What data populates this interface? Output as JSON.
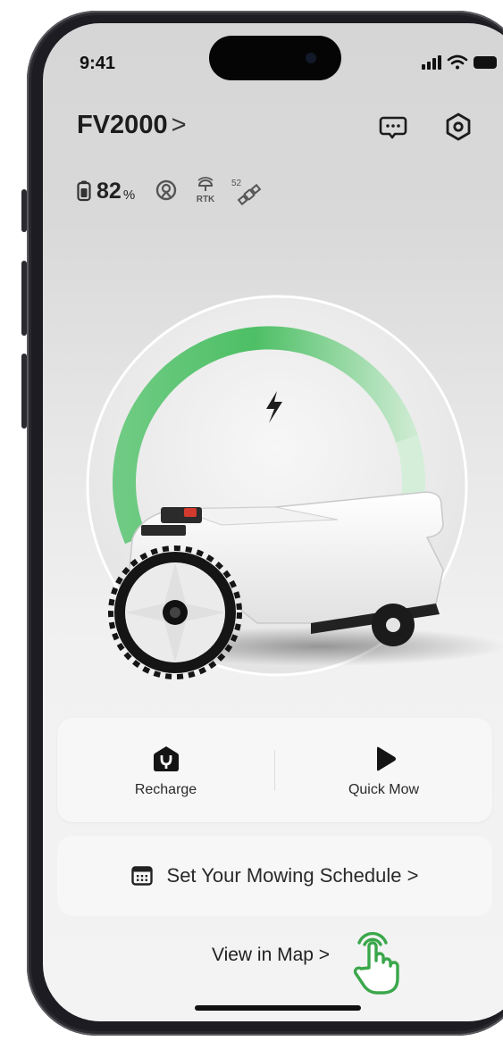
{
  "status_bar": {
    "time": "9:41"
  },
  "header": {
    "device_name": "FV2000",
    "chevron": ">"
  },
  "stats": {
    "battery_percent": "82",
    "battery_unit": "%",
    "satellites": "52",
    "rtk_label": "RTK",
    "charge_level": 0.82
  },
  "actions": {
    "recharge_label": "Recharge",
    "quick_mow_label": "Quick Mow"
  },
  "schedule": {
    "label": "Set Your Mowing Schedule",
    "chevron": ">"
  },
  "map_link": {
    "label": "View in Map",
    "chevron": ">"
  },
  "colors": {
    "accent_green": "#5cc46c",
    "arc_light": "#bfe6c4",
    "hand_green": "#3aa74a"
  },
  "icons": [
    "chat-icon",
    "settings-icon",
    "battery-icon",
    "signal-icon",
    "rtk-icon",
    "satellite-icon",
    "lightning-icon",
    "recharge-home-icon",
    "play-icon",
    "calendar-icon",
    "hand-pointer-icon"
  ]
}
